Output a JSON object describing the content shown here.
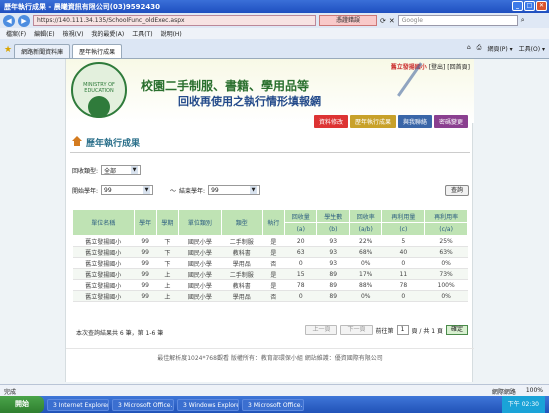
{
  "window": {
    "title": "歷年執行成果 - 晨曦資訊有限公司(03)9592430"
  },
  "address": {
    "url": "https://140.111.34.135/SchoolFunc_oldExec.aspx",
    "cert_warning": "憑證錯誤",
    "search_placeholder": "Google"
  },
  "menu": [
    "檔案(F)",
    "編輯(E)",
    "檢視(V)",
    "我的最愛(A)",
    "工具(T)",
    "說明(H)"
  ],
  "tabs": [
    "網路新聞資料庫",
    "歷年執行成果"
  ],
  "commands": [
    "網頁(P) ▾",
    "工具(O) ▾"
  ],
  "header": {
    "headline1": "校園二手制服、書籍、學用品等",
    "headline2": "回收再使用之執行情形填報網",
    "school": "舊立發揚國小",
    "links": "[登出] [回首頁]",
    "logo_text": "MINISTRY OF EDUCATION"
  },
  "nav": [
    {
      "label": "資料修改",
      "color": "#d33"
    },
    {
      "label": "歷年執行成果",
      "color": "#c8a12a"
    },
    {
      "label": "與我聯絡",
      "color": "#3a66a8"
    },
    {
      "label": "密碼變更",
      "color": "#8a3f8f"
    }
  ],
  "section": {
    "title": "歷年執行成果"
  },
  "filters": {
    "type_label": "回收類型:",
    "type_value": "全部",
    "start_label": "開始學年:",
    "start_value": "99",
    "sep": "～",
    "end_label": "結束學年:",
    "end_value": "99",
    "query": "查詢"
  },
  "table": {
    "headers": [
      "單位名稱",
      "學年",
      "學期",
      "單位類別",
      "類型",
      "執行",
      "回收量",
      "學生數",
      "回收率",
      "再利用量",
      "再利用率"
    ],
    "subheaders": [
      "(a)",
      "(b)",
      "(a/b)",
      "(c)",
      "(c/a)"
    ],
    "rows": [
      [
        "舊立發揚國小",
        "99",
        "下",
        "國民小學",
        "二手制服",
        "是",
        "20",
        "93",
        "22%",
        "5",
        "25%"
      ],
      [
        "舊立發揚國小",
        "99",
        "下",
        "國民小學",
        "教科書",
        "是",
        "63",
        "93",
        "68%",
        "40",
        "63%"
      ],
      [
        "舊立發揚國小",
        "99",
        "下",
        "國民小學",
        "學用品",
        "否",
        "0",
        "93",
        "0%",
        "0",
        "0%"
      ],
      [
        "舊立發揚國小",
        "99",
        "上",
        "國民小學",
        "二手制服",
        "是",
        "15",
        "89",
        "17%",
        "11",
        "73%"
      ],
      [
        "舊立發揚國小",
        "99",
        "上",
        "國民小學",
        "教科書",
        "是",
        "78",
        "89",
        "88%",
        "78",
        "100%"
      ],
      [
        "舊立發揚國小",
        "99",
        "上",
        "國民小學",
        "學用品",
        "否",
        "0",
        "89",
        "0%",
        "0",
        "0%"
      ]
    ]
  },
  "pager": {
    "summary": "本次查詢結果共 6 筆，第 1-6 筆",
    "prev": "上一頁",
    "next": "下一頁",
    "goto_prefix": "前往第",
    "page": "1",
    "goto_suffix": "頁 / 共 1 頁",
    "go": "確定"
  },
  "footnote": "最佳解析度1024*768觀看 版權所有：教育部環保小組 網站維護：優資國際有限公司",
  "status": {
    "left": "完成",
    "zone": "網際網路",
    "zoom": "100%"
  },
  "taskbar": {
    "start": "開始",
    "tasks": [
      "3 Internet Explorer",
      "3 Microsoft Office...",
      "3 Windows Explorer",
      "3 Microsoft Office..."
    ],
    "clock": "下午 02:30"
  }
}
